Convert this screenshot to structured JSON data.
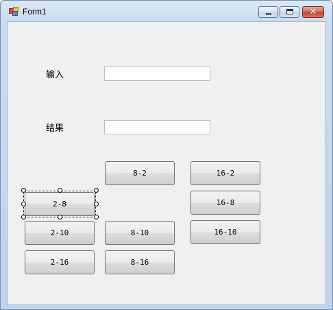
{
  "window": {
    "title": "Form1",
    "icon": "winforms-app-icon",
    "controls": {
      "minimize": "minimize-icon",
      "maximize": "maximize-icon",
      "close_glyph": "✕"
    }
  },
  "form": {
    "input_label": "输入",
    "result_label": "结果",
    "input_value": "",
    "result_value": ""
  },
  "buttons": {
    "b_8_2": "8-2",
    "b_16_2": "16-2",
    "b_2_8": "2-8",
    "b_16_8": "16-8",
    "b_2_10": "2-10",
    "b_8_10": "8-10",
    "b_16_10": "16-10",
    "b_2_16": "2-16",
    "b_8_16": "8-16"
  }
}
